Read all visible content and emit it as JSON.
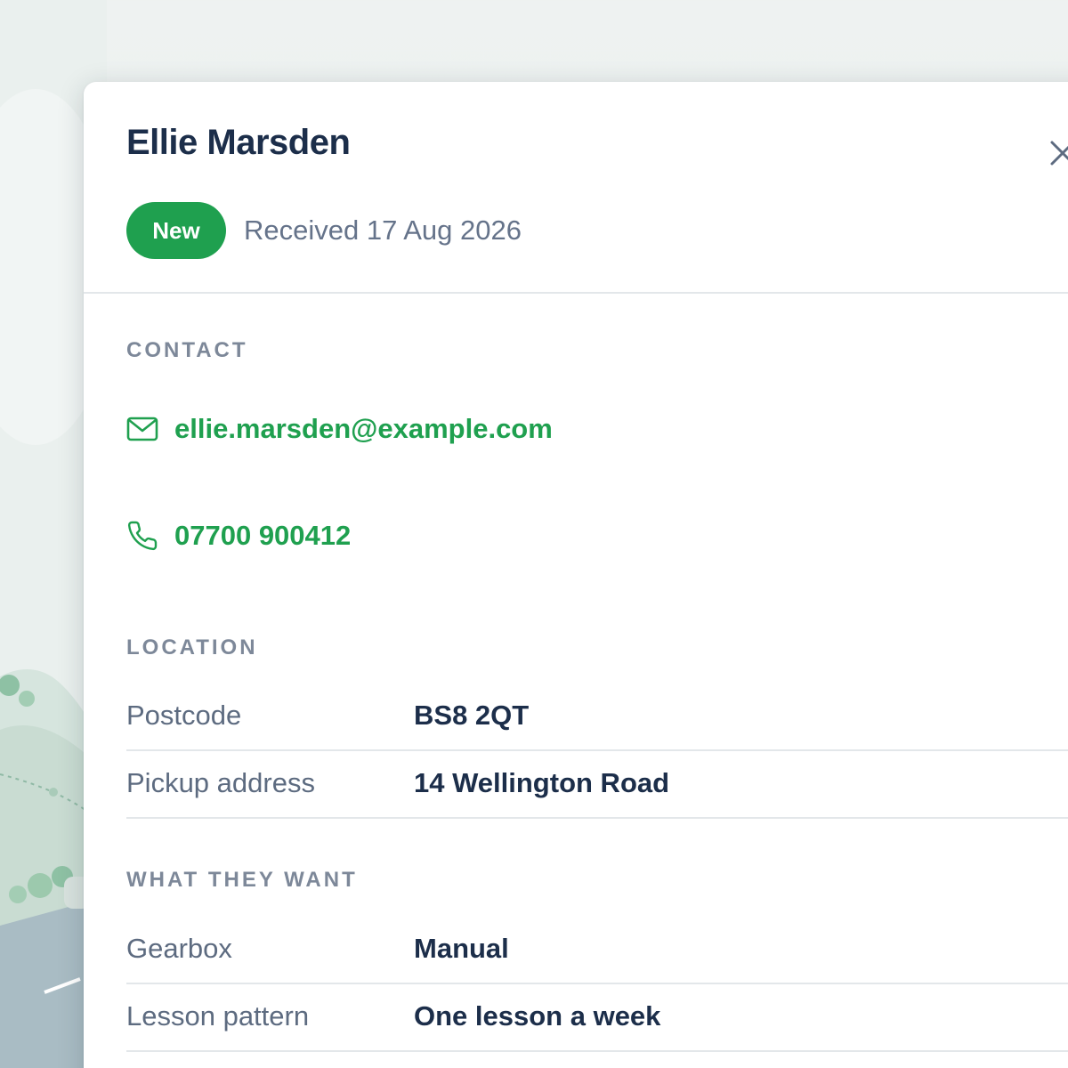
{
  "lead": {
    "name": "Ellie Marsden",
    "status": "New",
    "received": "Received 17 Aug 2026"
  },
  "contact": {
    "heading": "CONTACT",
    "email": "ellie.marsden@example.com",
    "phone": "07700 900412"
  },
  "location": {
    "heading": "LOCATION",
    "rows": [
      {
        "label": "Postcode",
        "value": "BS8 2QT"
      },
      {
        "label": "Pickup address",
        "value": "14 Wellington Road"
      }
    ]
  },
  "wants": {
    "heading": "WHAT THEY WANT",
    "rows": [
      {
        "label": "Gearbox",
        "value": "Manual"
      },
      {
        "label": "Lesson pattern",
        "value": "One lesson a week"
      }
    ]
  },
  "colors": {
    "accent": "#1fa04f",
    "heading": "#1c2e4a",
    "muted": "#65738a"
  },
  "icons": {
    "close": "close-icon",
    "email": "mail-icon",
    "phone": "phone-icon"
  }
}
